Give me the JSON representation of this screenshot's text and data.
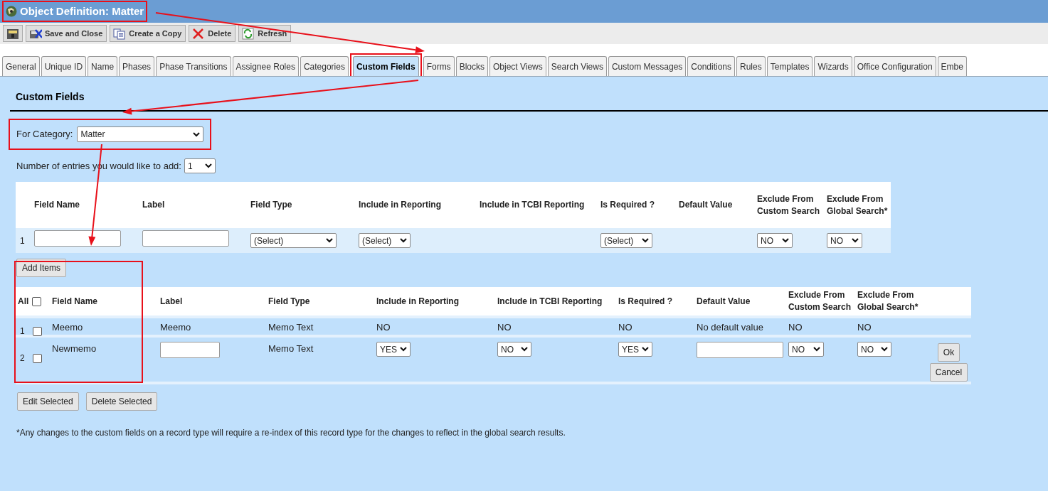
{
  "window": {
    "title": "Object Definition: Matter",
    "highlighted": true
  },
  "toolbar": [
    {
      "kind": "help"
    },
    {
      "kind": "save",
      "label": "Save and Close"
    },
    {
      "kind": "copy",
      "label": "Create a Copy"
    },
    {
      "kind": "delete",
      "label": "Delete"
    },
    {
      "kind": "refresh",
      "label": "Refresh"
    }
  ],
  "tabs": [
    {
      "label": "General",
      "selected": false
    },
    {
      "label": "Unique ID",
      "selected": false
    },
    {
      "label": "Name",
      "selected": false
    },
    {
      "label": "Phases",
      "selected": false
    },
    {
      "label": "Phase Transitions",
      "selected": false
    },
    {
      "label": "Assignee Roles",
      "selected": false
    },
    {
      "label": "Categories",
      "selected": false
    },
    {
      "label": "Custom Fields",
      "selected": true,
      "highlighted": true
    },
    {
      "label": "Forms",
      "selected": false
    },
    {
      "label": "Blocks",
      "selected": false
    },
    {
      "label": "Object Views",
      "selected": false
    },
    {
      "label": "Search Views",
      "selected": false
    },
    {
      "label": "Custom Messages",
      "selected": false
    },
    {
      "label": "Conditions",
      "selected": false
    },
    {
      "label": "Rules",
      "selected": false
    },
    {
      "label": "Templates",
      "selected": false
    },
    {
      "label": "Wizards",
      "selected": false
    },
    {
      "label": "Office Configuration",
      "selected": false
    },
    {
      "label": "Embe",
      "selected": false
    }
  ],
  "section_title": "Custom Fields",
  "category": {
    "label": "For Category:",
    "value": "Matter",
    "highlighted": true
  },
  "entries": {
    "label": "Number of entries you would like to add:",
    "value": "1"
  },
  "new_table": {
    "columns": [
      "",
      "Field Name",
      "Label",
      "Field Type",
      "Include in Reporting",
      "Include in TCBI Reporting",
      "Is Required ?",
      "Default Value",
      "Exclude From Custom Search",
      "Exclude From Global Search*"
    ],
    "rows": [
      {
        "cells": [
          {
            "kind": "number",
            "value": "1"
          },
          {
            "kind": "input"
          },
          {
            "kind": "input"
          },
          {
            "kind": "select",
            "value": "(Select)"
          },
          {
            "kind": "select",
            "value": "(Select)"
          },
          {
            "kind": "empty"
          },
          {
            "kind": "select",
            "value": "(Select)"
          },
          {
            "kind": "empty"
          },
          {
            "kind": "select",
            "value": "NO"
          },
          {
            "kind": "select",
            "value": "NO"
          }
        ]
      }
    ]
  },
  "add_button": "Add Items",
  "list_table": {
    "select_all_label": "All",
    "select_all_checked": false,
    "highlight_select_column": true,
    "columns": [
      "Field Name",
      "Label",
      "Field Type",
      "Include in Reporting",
      "Include in TCBI Reporting",
      "Is Required ?",
      "Default Value",
      "Exclude From Custom Search",
      "Exclude From Global Search*"
    ],
    "rows": [
      {
        "number": "1",
        "checked": false,
        "cells": [
          {
            "kind": "text",
            "value": "Meemo"
          },
          {
            "kind": "text",
            "value": "Meemo"
          },
          {
            "kind": "text",
            "value": "Memo Text"
          },
          {
            "kind": "text",
            "value": "NO"
          },
          {
            "kind": "text",
            "value": "NO"
          },
          {
            "kind": "text",
            "value": "NO"
          },
          {
            "kind": "text",
            "value": "No default value"
          },
          {
            "kind": "text",
            "value": "NO"
          },
          {
            "kind": "text",
            "value": "NO"
          }
        ]
      },
      {
        "number": "2",
        "checked": false,
        "cells": [
          {
            "kind": "text",
            "value": "Newmemo"
          },
          {
            "kind": "input"
          },
          {
            "kind": "text",
            "value": "Memo Text"
          },
          {
            "kind": "select",
            "value": "YES"
          },
          {
            "kind": "select",
            "value": "NO"
          },
          {
            "kind": "select",
            "value": "YES"
          },
          {
            "kind": "input"
          },
          {
            "kind": "select",
            "value": "NO"
          },
          {
            "kind": "select",
            "value": "NO"
          }
        ],
        "actions": [
          "Ok",
          "Cancel"
        ]
      }
    ]
  },
  "bottom_buttons": [
    "Edit Selected",
    "Delete Selected"
  ],
  "footnote": "*Any changes to the custom fields on a record type will require a re-index of this record type for the changes to reflect in the global search results."
}
